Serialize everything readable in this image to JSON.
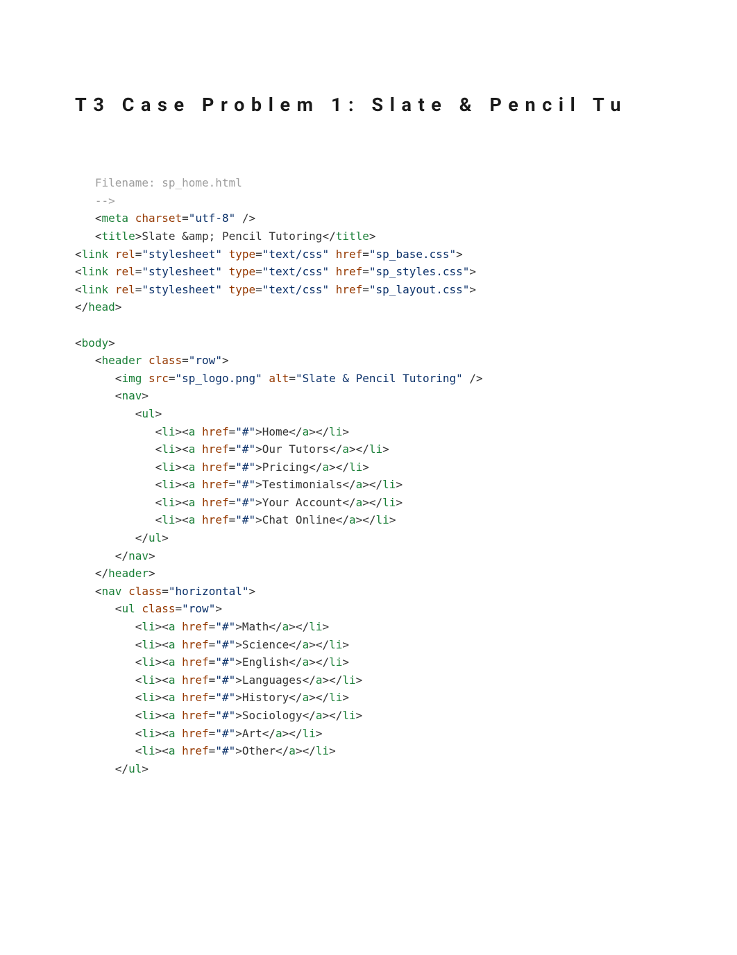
{
  "title": "T3 Case Problem 1: Slate & Pencil Tu",
  "lines": [
    [
      [
        "gray",
        "   Filename: sp_home.html"
      ]
    ],
    [
      [
        "gray",
        "   -->"
      ]
    ],
    [
      [
        "punct",
        "   <"
      ],
      [
        "tag",
        "meta"
      ],
      [
        "punct",
        " "
      ],
      [
        "attr",
        "charset"
      ],
      [
        "punct",
        "="
      ],
      [
        "str",
        "\"utf-8\""
      ],
      [
        "punct",
        " />"
      ]
    ],
    [
      [
        "punct",
        "   <"
      ],
      [
        "tag",
        "title"
      ],
      [
        "punct",
        ">"
      ],
      [
        "inner",
        "Slate &amp; Pencil Tutoring"
      ],
      [
        "punct",
        "</"
      ],
      [
        "tag",
        "title"
      ],
      [
        "punct",
        ">"
      ]
    ],
    [
      [
        "punct",
        "<"
      ],
      [
        "tag",
        "link"
      ],
      [
        "punct",
        " "
      ],
      [
        "attr",
        "rel"
      ],
      [
        "punct",
        "="
      ],
      [
        "str",
        "\"stylesheet\""
      ],
      [
        "punct",
        " "
      ],
      [
        "attr",
        "type"
      ],
      [
        "punct",
        "="
      ],
      [
        "str",
        "\"text/css\""
      ],
      [
        "punct",
        " "
      ],
      [
        "attr",
        "href"
      ],
      [
        "punct",
        "="
      ],
      [
        "str",
        "\"sp_base.css\""
      ],
      [
        "punct",
        ">"
      ]
    ],
    [
      [
        "punct",
        "<"
      ],
      [
        "tag",
        "link"
      ],
      [
        "punct",
        " "
      ],
      [
        "attr",
        "rel"
      ],
      [
        "punct",
        "="
      ],
      [
        "str",
        "\"stylesheet\""
      ],
      [
        "punct",
        " "
      ],
      [
        "attr",
        "type"
      ],
      [
        "punct",
        "="
      ],
      [
        "str",
        "\"text/css\""
      ],
      [
        "punct",
        " "
      ],
      [
        "attr",
        "href"
      ],
      [
        "punct",
        "="
      ],
      [
        "str",
        "\"sp_styles.css\""
      ],
      [
        "punct",
        ">"
      ]
    ],
    [
      [
        "punct",
        "<"
      ],
      [
        "tag",
        "link"
      ],
      [
        "punct",
        " "
      ],
      [
        "attr",
        "rel"
      ],
      [
        "punct",
        "="
      ],
      [
        "str",
        "\"stylesheet\""
      ],
      [
        "punct",
        " "
      ],
      [
        "attr",
        "type"
      ],
      [
        "punct",
        "="
      ],
      [
        "str",
        "\"text/css\""
      ],
      [
        "punct",
        " "
      ],
      [
        "attr",
        "href"
      ],
      [
        "punct",
        "="
      ],
      [
        "str",
        "\"sp_layout.css\""
      ],
      [
        "punct",
        ">"
      ]
    ],
    [
      [
        "punct",
        "</"
      ],
      [
        "tag",
        "head"
      ],
      [
        "punct",
        ">"
      ]
    ],
    [
      [
        "punct",
        ""
      ]
    ],
    [
      [
        "punct",
        "<"
      ],
      [
        "tag",
        "body"
      ],
      [
        "punct",
        ">"
      ]
    ],
    [
      [
        "punct",
        "   <"
      ],
      [
        "tag",
        "header"
      ],
      [
        "punct",
        " "
      ],
      [
        "attr",
        "class"
      ],
      [
        "punct",
        "="
      ],
      [
        "str",
        "\"row\""
      ],
      [
        "punct",
        ">"
      ]
    ],
    [
      [
        "punct",
        "      <"
      ],
      [
        "tag",
        "img"
      ],
      [
        "punct",
        " "
      ],
      [
        "attr",
        "src"
      ],
      [
        "punct",
        "="
      ],
      [
        "str",
        "\"sp_logo.png\""
      ],
      [
        "punct",
        " "
      ],
      [
        "attr",
        "alt"
      ],
      [
        "punct",
        "="
      ],
      [
        "str",
        "\"Slate & Pencil Tutoring\""
      ],
      [
        "punct",
        " />"
      ]
    ],
    [
      [
        "punct",
        "      <"
      ],
      [
        "tag",
        "nav"
      ],
      [
        "punct",
        ">"
      ]
    ],
    [
      [
        "punct",
        "         <"
      ],
      [
        "tag",
        "ul"
      ],
      [
        "punct",
        ">"
      ]
    ],
    [
      [
        "punct",
        "            <"
      ],
      [
        "tag",
        "li"
      ],
      [
        "punct",
        "><"
      ],
      [
        "tag",
        "a"
      ],
      [
        "punct",
        " "
      ],
      [
        "attr",
        "href"
      ],
      [
        "punct",
        "="
      ],
      [
        "str",
        "\"#\""
      ],
      [
        "punct",
        ">"
      ],
      [
        "inner",
        "Home"
      ],
      [
        "punct",
        "</"
      ],
      [
        "tag",
        "a"
      ],
      [
        "punct",
        "></"
      ],
      [
        "tag",
        "li"
      ],
      [
        "punct",
        ">"
      ]
    ],
    [
      [
        "punct",
        "            <"
      ],
      [
        "tag",
        "li"
      ],
      [
        "punct",
        "><"
      ],
      [
        "tag",
        "a"
      ],
      [
        "punct",
        " "
      ],
      [
        "attr",
        "href"
      ],
      [
        "punct",
        "="
      ],
      [
        "str",
        "\"#\""
      ],
      [
        "punct",
        ">"
      ],
      [
        "inner",
        "Our Tutors"
      ],
      [
        "punct",
        "</"
      ],
      [
        "tag",
        "a"
      ],
      [
        "punct",
        "></"
      ],
      [
        "tag",
        "li"
      ],
      [
        "punct",
        ">"
      ]
    ],
    [
      [
        "punct",
        "            <"
      ],
      [
        "tag",
        "li"
      ],
      [
        "punct",
        "><"
      ],
      [
        "tag",
        "a"
      ],
      [
        "punct",
        " "
      ],
      [
        "attr",
        "href"
      ],
      [
        "punct",
        "="
      ],
      [
        "str",
        "\"#\""
      ],
      [
        "punct",
        ">"
      ],
      [
        "inner",
        "Pricing"
      ],
      [
        "punct",
        "</"
      ],
      [
        "tag",
        "a"
      ],
      [
        "punct",
        "></"
      ],
      [
        "tag",
        "li"
      ],
      [
        "punct",
        ">"
      ]
    ],
    [
      [
        "punct",
        "            <"
      ],
      [
        "tag",
        "li"
      ],
      [
        "punct",
        "><"
      ],
      [
        "tag",
        "a"
      ],
      [
        "punct",
        " "
      ],
      [
        "attr",
        "href"
      ],
      [
        "punct",
        "="
      ],
      [
        "str",
        "\"#\""
      ],
      [
        "punct",
        ">"
      ],
      [
        "inner",
        "Testimonials"
      ],
      [
        "punct",
        "</"
      ],
      [
        "tag",
        "a"
      ],
      [
        "punct",
        "></"
      ],
      [
        "tag",
        "li"
      ],
      [
        "punct",
        ">"
      ]
    ],
    [
      [
        "punct",
        "            <"
      ],
      [
        "tag",
        "li"
      ],
      [
        "punct",
        "><"
      ],
      [
        "tag",
        "a"
      ],
      [
        "punct",
        " "
      ],
      [
        "attr",
        "href"
      ],
      [
        "punct",
        "="
      ],
      [
        "str",
        "\"#\""
      ],
      [
        "punct",
        ">"
      ],
      [
        "inner",
        "Your Account"
      ],
      [
        "punct",
        "</"
      ],
      [
        "tag",
        "a"
      ],
      [
        "punct",
        "></"
      ],
      [
        "tag",
        "li"
      ],
      [
        "punct",
        ">"
      ]
    ],
    [
      [
        "punct",
        "            <"
      ],
      [
        "tag",
        "li"
      ],
      [
        "punct",
        "><"
      ],
      [
        "tag",
        "a"
      ],
      [
        "punct",
        " "
      ],
      [
        "attr",
        "href"
      ],
      [
        "punct",
        "="
      ],
      [
        "str",
        "\"#\""
      ],
      [
        "punct",
        ">"
      ],
      [
        "inner",
        "Chat Online"
      ],
      [
        "punct",
        "</"
      ],
      [
        "tag",
        "a"
      ],
      [
        "punct",
        "></"
      ],
      [
        "tag",
        "li"
      ],
      [
        "punct",
        ">"
      ]
    ],
    [
      [
        "punct",
        "         </"
      ],
      [
        "tag",
        "ul"
      ],
      [
        "punct",
        ">"
      ]
    ],
    [
      [
        "punct",
        "      </"
      ],
      [
        "tag",
        "nav"
      ],
      [
        "punct",
        ">"
      ]
    ],
    [
      [
        "punct",
        "   </"
      ],
      [
        "tag",
        "header"
      ],
      [
        "punct",
        ">"
      ]
    ],
    [
      [
        "punct",
        "   <"
      ],
      [
        "tag",
        "nav"
      ],
      [
        "punct",
        " "
      ],
      [
        "attr",
        "class"
      ],
      [
        "punct",
        "="
      ],
      [
        "str",
        "\"horizontal\""
      ],
      [
        "punct",
        ">"
      ]
    ],
    [
      [
        "punct",
        "      <"
      ],
      [
        "tag",
        "ul"
      ],
      [
        "punct",
        " "
      ],
      [
        "attr",
        "class"
      ],
      [
        "punct",
        "="
      ],
      [
        "str",
        "\"row\""
      ],
      [
        "punct",
        ">"
      ]
    ],
    [
      [
        "punct",
        "         <"
      ],
      [
        "tag",
        "li"
      ],
      [
        "punct",
        "><"
      ],
      [
        "tag",
        "a"
      ],
      [
        "punct",
        " "
      ],
      [
        "attr",
        "href"
      ],
      [
        "punct",
        "="
      ],
      [
        "str",
        "\"#\""
      ],
      [
        "punct",
        ">"
      ],
      [
        "inner",
        "Math"
      ],
      [
        "punct",
        "</"
      ],
      [
        "tag",
        "a"
      ],
      [
        "punct",
        "></"
      ],
      [
        "tag",
        "li"
      ],
      [
        "punct",
        ">"
      ]
    ],
    [
      [
        "punct",
        "         <"
      ],
      [
        "tag",
        "li"
      ],
      [
        "punct",
        "><"
      ],
      [
        "tag",
        "a"
      ],
      [
        "punct",
        " "
      ],
      [
        "attr",
        "href"
      ],
      [
        "punct",
        "="
      ],
      [
        "str",
        "\"#\""
      ],
      [
        "punct",
        ">"
      ],
      [
        "inner",
        "Science"
      ],
      [
        "punct",
        "</"
      ],
      [
        "tag",
        "a"
      ],
      [
        "punct",
        "></"
      ],
      [
        "tag",
        "li"
      ],
      [
        "punct",
        ">"
      ]
    ],
    [
      [
        "punct",
        "         <"
      ],
      [
        "tag",
        "li"
      ],
      [
        "punct",
        "><"
      ],
      [
        "tag",
        "a"
      ],
      [
        "punct",
        " "
      ],
      [
        "attr",
        "href"
      ],
      [
        "punct",
        "="
      ],
      [
        "str",
        "\"#\""
      ],
      [
        "punct",
        ">"
      ],
      [
        "inner",
        "English"
      ],
      [
        "punct",
        "</"
      ],
      [
        "tag",
        "a"
      ],
      [
        "punct",
        "></"
      ],
      [
        "tag",
        "li"
      ],
      [
        "punct",
        ">"
      ]
    ],
    [
      [
        "punct",
        "         <"
      ],
      [
        "tag",
        "li"
      ],
      [
        "punct",
        "><"
      ],
      [
        "tag",
        "a"
      ],
      [
        "punct",
        " "
      ],
      [
        "attr",
        "href"
      ],
      [
        "punct",
        "="
      ],
      [
        "str",
        "\"#\""
      ],
      [
        "punct",
        ">"
      ],
      [
        "inner",
        "Languages"
      ],
      [
        "punct",
        "</"
      ],
      [
        "tag",
        "a"
      ],
      [
        "punct",
        "></"
      ],
      [
        "tag",
        "li"
      ],
      [
        "punct",
        ">"
      ]
    ],
    [
      [
        "punct",
        "         <"
      ],
      [
        "tag",
        "li"
      ],
      [
        "punct",
        "><"
      ],
      [
        "tag",
        "a"
      ],
      [
        "punct",
        " "
      ],
      [
        "attr",
        "href"
      ],
      [
        "punct",
        "="
      ],
      [
        "str",
        "\"#\""
      ],
      [
        "punct",
        ">"
      ],
      [
        "inner",
        "History"
      ],
      [
        "punct",
        "</"
      ],
      [
        "tag",
        "a"
      ],
      [
        "punct",
        "></"
      ],
      [
        "tag",
        "li"
      ],
      [
        "punct",
        ">"
      ]
    ],
    [
      [
        "punct",
        "         <"
      ],
      [
        "tag",
        "li"
      ],
      [
        "punct",
        "><"
      ],
      [
        "tag",
        "a"
      ],
      [
        "punct",
        " "
      ],
      [
        "attr",
        "href"
      ],
      [
        "punct",
        "="
      ],
      [
        "str",
        "\"#\""
      ],
      [
        "punct",
        ">"
      ],
      [
        "inner",
        "Sociology"
      ],
      [
        "punct",
        "</"
      ],
      [
        "tag",
        "a"
      ],
      [
        "punct",
        "></"
      ],
      [
        "tag",
        "li"
      ],
      [
        "punct",
        ">"
      ]
    ],
    [
      [
        "punct",
        "         <"
      ],
      [
        "tag",
        "li"
      ],
      [
        "punct",
        "><"
      ],
      [
        "tag",
        "a"
      ],
      [
        "punct",
        " "
      ],
      [
        "attr",
        "href"
      ],
      [
        "punct",
        "="
      ],
      [
        "str",
        "\"#\""
      ],
      [
        "punct",
        ">"
      ],
      [
        "inner",
        "Art"
      ],
      [
        "punct",
        "</"
      ],
      [
        "tag",
        "a"
      ],
      [
        "punct",
        "></"
      ],
      [
        "tag",
        "li"
      ],
      [
        "punct",
        ">"
      ]
    ],
    [
      [
        "punct",
        "         <"
      ],
      [
        "tag",
        "li"
      ],
      [
        "punct",
        "><"
      ],
      [
        "tag",
        "a"
      ],
      [
        "punct",
        " "
      ],
      [
        "attr",
        "href"
      ],
      [
        "punct",
        "="
      ],
      [
        "str",
        "\"#\""
      ],
      [
        "punct",
        ">"
      ],
      [
        "inner",
        "Other"
      ],
      [
        "punct",
        "</"
      ],
      [
        "tag",
        "a"
      ],
      [
        "punct",
        "></"
      ],
      [
        "tag",
        "li"
      ],
      [
        "punct",
        ">"
      ]
    ],
    [
      [
        "punct",
        "      </"
      ],
      [
        "tag",
        "ul"
      ],
      [
        "punct",
        ">"
      ]
    ]
  ]
}
